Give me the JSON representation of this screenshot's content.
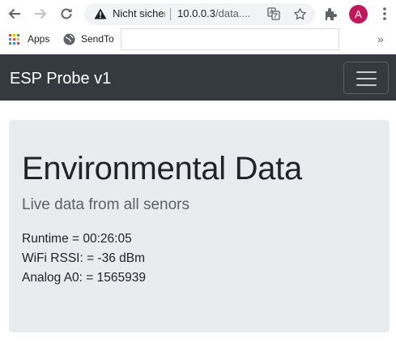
{
  "browser": {
    "security_status": "Nicht sicher",
    "url_host": "10.0.0.3",
    "url_path": "/data....",
    "avatar_initial": "A"
  },
  "bookmarks": {
    "apps_label": "Apps",
    "sendto_label": "SendTo",
    "more_label": "»"
  },
  "navbar": {
    "brand": "ESP Probe v1"
  },
  "jumbotron": {
    "title": "Environmental Data",
    "lead": "Live data from all senors",
    "lines": [
      "Runtime = 00:26:05",
      "WiFi RSSI: = -36 dBm",
      "Analog A0: = 1565939"
    ]
  },
  "colors": {
    "navbar_bg": "#343a40",
    "jumbotron_bg": "#e9ecef",
    "avatar_bg": "#c2185b"
  },
  "icons": [
    "back-arrow-icon",
    "forward-arrow-icon",
    "reload-icon",
    "warning-icon",
    "translate-icon",
    "star-icon",
    "extensions-icon",
    "menu-dots-icon",
    "apps-grid-icon",
    "globe-icon",
    "hamburger-icon"
  ]
}
